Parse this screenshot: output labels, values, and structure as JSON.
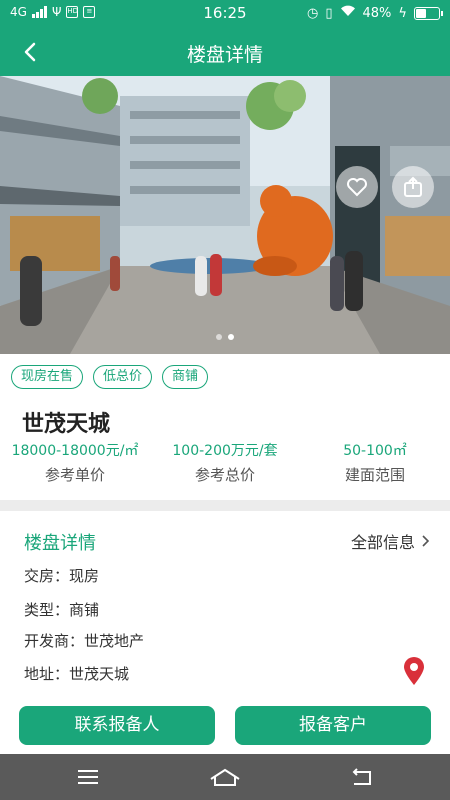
{
  "status_bar": {
    "network": "4G",
    "time": "16:25",
    "battery": "48%",
    "battery_level": 0.48,
    "icons": [
      "signal-icon",
      "usb-icon",
      "volte-icon",
      "notification-icon",
      "alarm-icon",
      "vibrate-icon",
      "wifi-icon",
      "charging-icon",
      "battery-icon"
    ]
  },
  "nav": {
    "title": "楼盘详情",
    "back_icon": "chevron-left-icon"
  },
  "hero": {
    "photo": "shopping-mall-atrium-photo",
    "slide_count": 2,
    "active_slide": 1,
    "colors": {
      "teal": "#1aa67a",
      "bear": "#e06a1f"
    }
  },
  "tags": [
    "现房在售",
    "低总价",
    "商铺"
  ],
  "project": {
    "name": "世茂天城",
    "unit_price": "18000-18000元/㎡",
    "unit_price_label": "参考单价",
    "total_price": "100-200万元/套",
    "total_price_label": "参考总价",
    "area": "50-100㎡",
    "area_label": "建面范围"
  },
  "details": {
    "title": "楼盘详情",
    "all_info": "全部信息",
    "delivery": "交房：现房",
    "type": "类型：商铺",
    "developer": "开发商：世茂地产",
    "address": "地址：世茂天城"
  },
  "actions": {
    "contact": "联系报备人",
    "report": "报备客户"
  },
  "colors": {
    "primary": "#1aa67a",
    "pin": "#d9303a",
    "system_nav": "#5a5a5a"
  }
}
